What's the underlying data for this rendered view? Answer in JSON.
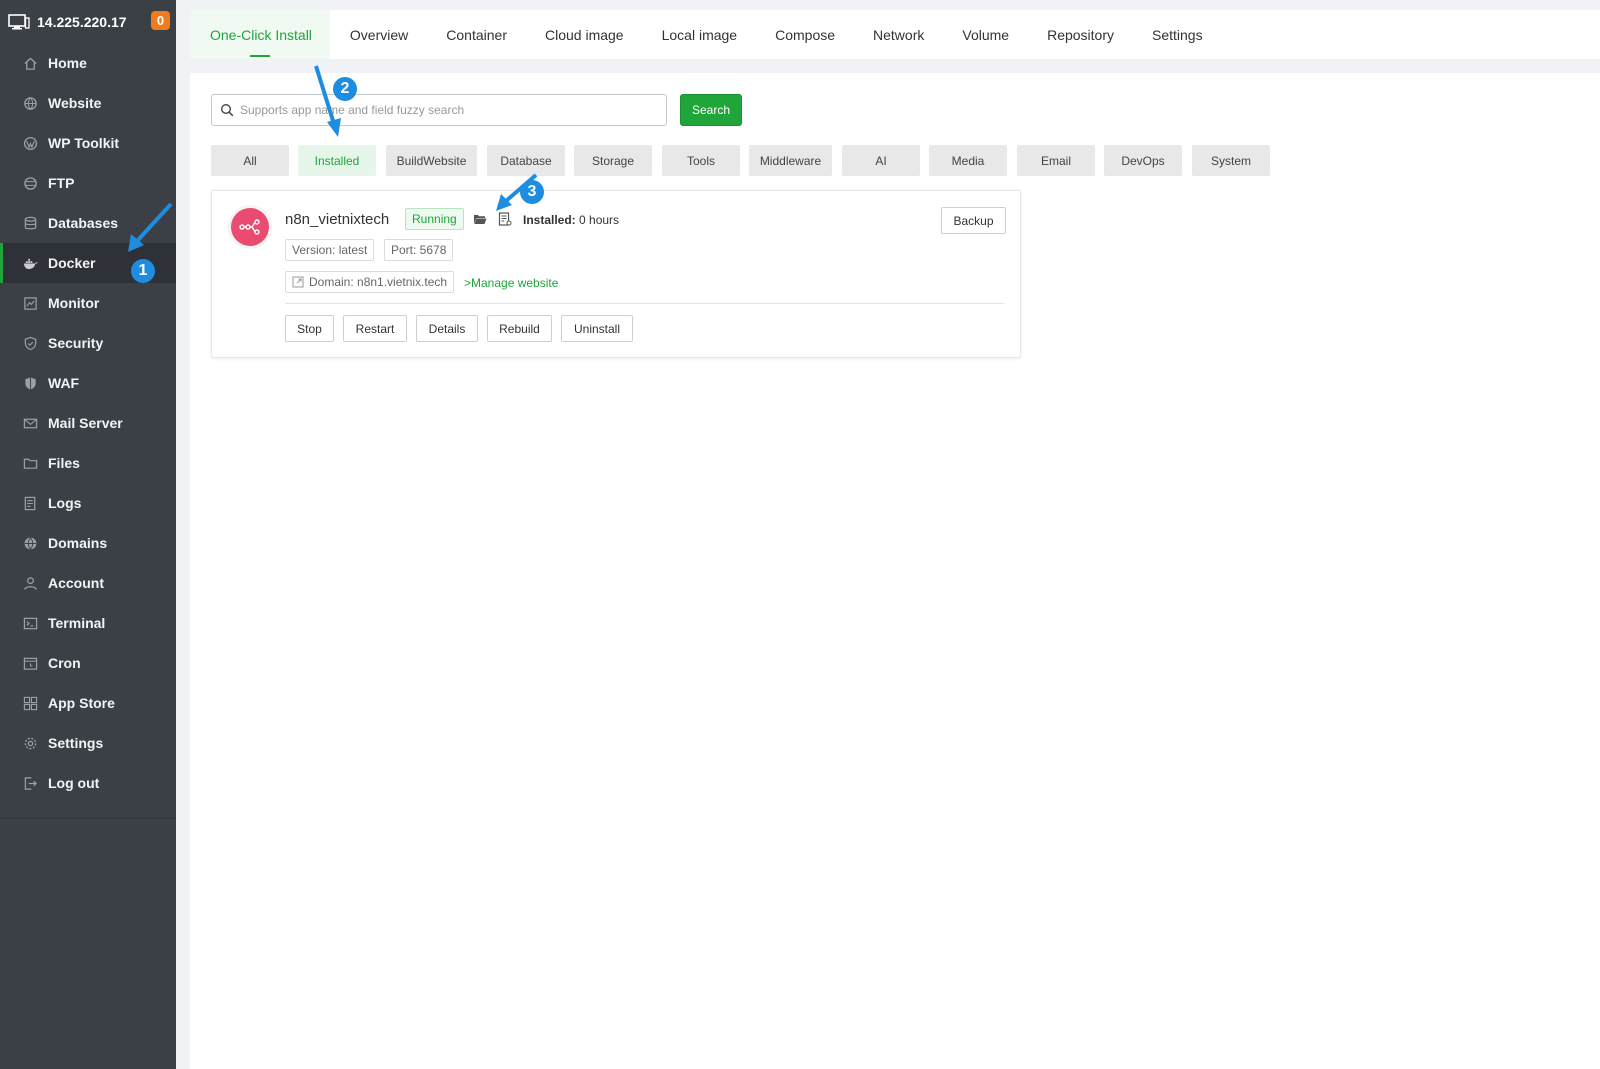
{
  "server": {
    "ip": "14.225.220.17",
    "notifications": "0"
  },
  "sidebar": {
    "items": [
      {
        "label": "Home",
        "icon": "home-icon"
      },
      {
        "label": "Website",
        "icon": "globe-icon"
      },
      {
        "label": "WP Toolkit",
        "icon": "wordpress-icon"
      },
      {
        "label": "FTP",
        "icon": "ftp-icon"
      },
      {
        "label": "Databases",
        "icon": "database-icon"
      },
      {
        "label": "Docker",
        "icon": "docker-icon"
      },
      {
        "label": "Monitor",
        "icon": "monitor-icon"
      },
      {
        "label": "Security",
        "icon": "shield-icon"
      },
      {
        "label": "WAF",
        "icon": "waf-shield-icon"
      },
      {
        "label": "Mail Server",
        "icon": "mail-icon"
      },
      {
        "label": "Files",
        "icon": "folder-icon"
      },
      {
        "label": "Logs",
        "icon": "log-icon"
      },
      {
        "label": "Domains",
        "icon": "domain-icon"
      },
      {
        "label": "Account",
        "icon": "user-icon"
      },
      {
        "label": "Terminal",
        "icon": "terminal-icon"
      },
      {
        "label": "Cron",
        "icon": "cron-icon"
      },
      {
        "label": "App Store",
        "icon": "app-store-icon"
      },
      {
        "label": "Settings",
        "icon": "gear-icon"
      },
      {
        "label": "Log out",
        "icon": "logout-icon"
      }
    ]
  },
  "tabs": [
    {
      "label": "One-Click Install"
    },
    {
      "label": "Overview"
    },
    {
      "label": "Container"
    },
    {
      "label": "Cloud image"
    },
    {
      "label": "Local image"
    },
    {
      "label": "Compose"
    },
    {
      "label": "Network"
    },
    {
      "label": "Volume"
    },
    {
      "label": "Repository"
    },
    {
      "label": "Settings"
    }
  ],
  "search": {
    "placeholder": "Supports app name and field fuzzy search",
    "button_label": "Search"
  },
  "categories": [
    "All",
    "Installed",
    "BuildWebsite",
    "Database",
    "Storage",
    "Tools",
    "Middleware",
    "AI",
    "Media",
    "Email",
    "DevOps",
    "System"
  ],
  "app": {
    "name": "n8n_vietnixtech",
    "status": "Running",
    "installed_label": "Installed:",
    "installed_value": "0 hours",
    "version": "Version: latest",
    "port": "Port: 5678",
    "domain": "Domain: n8n1.vietnix.tech",
    "manage_link": ">Manage website",
    "backup_label": "Backup",
    "actions": [
      "Stop",
      "Restart",
      "Details",
      "Rebuild",
      "Uninstall"
    ]
  },
  "annotations": {
    "step1": "1",
    "step2": "2",
    "step3": "3"
  },
  "colors": {
    "sidebar_bg": "#3b4047",
    "accent_green": "#20a53a",
    "badge_orange": "#f07b1d",
    "annotation_blue": "#1e8de0",
    "app_logo": "#ea4b71"
  }
}
